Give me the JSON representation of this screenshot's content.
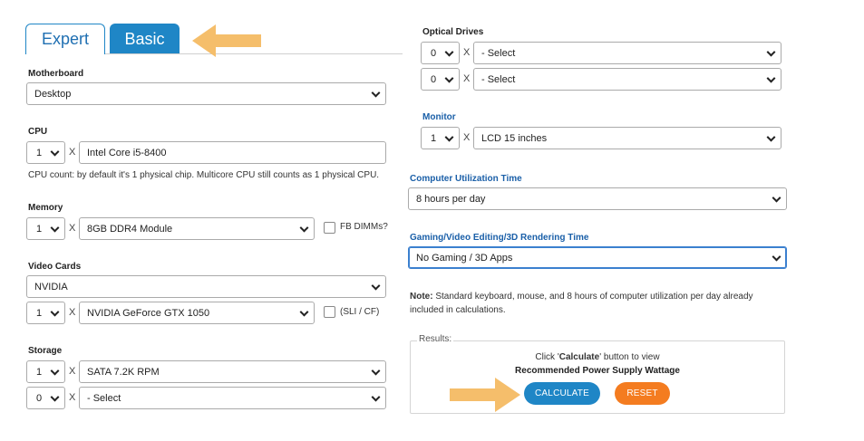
{
  "tabs": {
    "expert": "Expert",
    "basic": "Basic"
  },
  "motherboard": {
    "label": "Motherboard",
    "value": "Desktop"
  },
  "cpu": {
    "label": "CPU",
    "count": "1",
    "x": "X",
    "value": "Intel Core i5-8400",
    "note": "CPU count: by default it's 1 physical chip. Multicore CPU still counts as 1 physical CPU."
  },
  "memory": {
    "label": "Memory",
    "count": "1",
    "x": "X",
    "value": "8GB DDR4 Module",
    "checkbox_label": "FB DIMMs?"
  },
  "video_cards": {
    "label": "Video Cards",
    "brand": "NVIDIA",
    "count": "1",
    "x": "X",
    "model": "NVIDIA GeForce GTX 1050",
    "checkbox_label": "(SLI / CF)"
  },
  "storage": {
    "label": "Storage",
    "rows": [
      {
        "count": "1",
        "x": "X",
        "value": "SATA 7.2K RPM"
      },
      {
        "count": "0",
        "x": "X",
        "value": "- Select"
      }
    ]
  },
  "optical_drives": {
    "label": "Optical Drives",
    "rows": [
      {
        "count": "0",
        "x": "X",
        "value": "- Select"
      },
      {
        "count": "0",
        "x": "X",
        "value": "- Select"
      }
    ]
  },
  "monitor": {
    "label": "Monitor",
    "count": "1",
    "x": "X",
    "value": "LCD 15 inches"
  },
  "utilization": {
    "label": "Computer Utilization Time",
    "value": "8 hours per day"
  },
  "gaming": {
    "label": "Gaming/Video Editing/3D Rendering Time",
    "value": "No Gaming / 3D Apps"
  },
  "note": {
    "prefix": "Note:",
    "text": " Standard keyboard, mouse, and 8 hours of computer utilization per day already included in calculations."
  },
  "results": {
    "legend": "Results:",
    "line1_pre": "Click '",
    "line1_bold": "Calculate",
    "line1_post": "' button to view",
    "line2": "Recommended Power Supply Wattage",
    "calculate": "CALCULATE",
    "reset": "RESET"
  },
  "colors": {
    "accent": "#1f86c6",
    "label_blue": "#1a5fa8",
    "reset": "#f47c20",
    "arrow": "#f5be6b"
  }
}
